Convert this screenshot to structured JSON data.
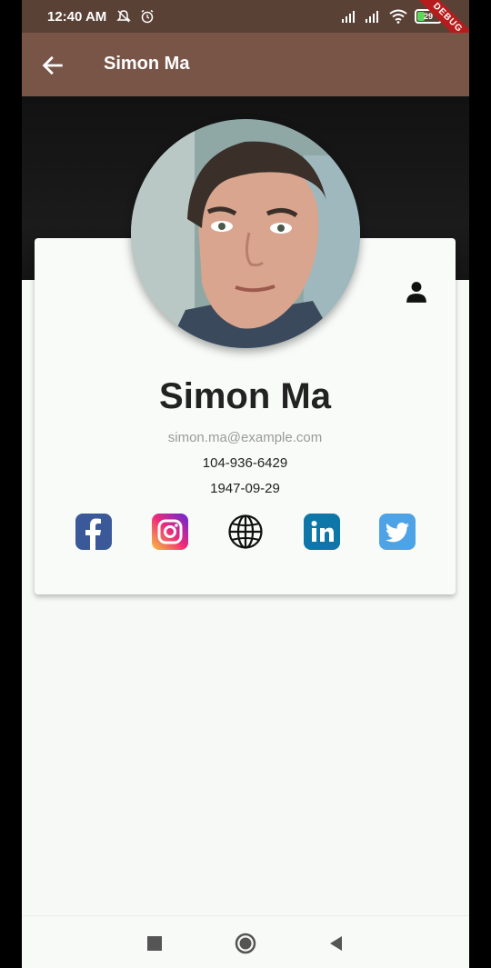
{
  "status_bar": {
    "time": "12:40 AM",
    "battery_level": "29",
    "debug_label": "DEBUG",
    "icons": [
      "notifications-off-icon",
      "alarm-icon",
      "signal-icon",
      "signal-icon",
      "wifi-icon",
      "battery-icon"
    ]
  },
  "app_bar": {
    "title": "Simon Ma",
    "back_icon": "arrow-back-icon",
    "color": "#795548"
  },
  "profile": {
    "name": "Simon Ma",
    "email": "simon.ma@example.com",
    "phone": "104-936-6429",
    "dob": "1947-09-29",
    "person_icon": "person-icon"
  },
  "social_links": [
    {
      "name": "facebook",
      "icon": "facebook-icon",
      "color": "#3b5998"
    },
    {
      "name": "instagram",
      "icon": "instagram-icon",
      "color": "#e1306c"
    },
    {
      "name": "website",
      "icon": "globe-icon",
      "color": "#000000"
    },
    {
      "name": "linkedin",
      "icon": "linkedin-icon",
      "color": "#0e76a8"
    },
    {
      "name": "twitter",
      "icon": "twitter-icon",
      "color": "#4ea3e6"
    }
  ],
  "nav_bar": {
    "buttons": [
      "recents-square-icon",
      "home-circle-icon",
      "back-triangle-icon"
    ]
  }
}
